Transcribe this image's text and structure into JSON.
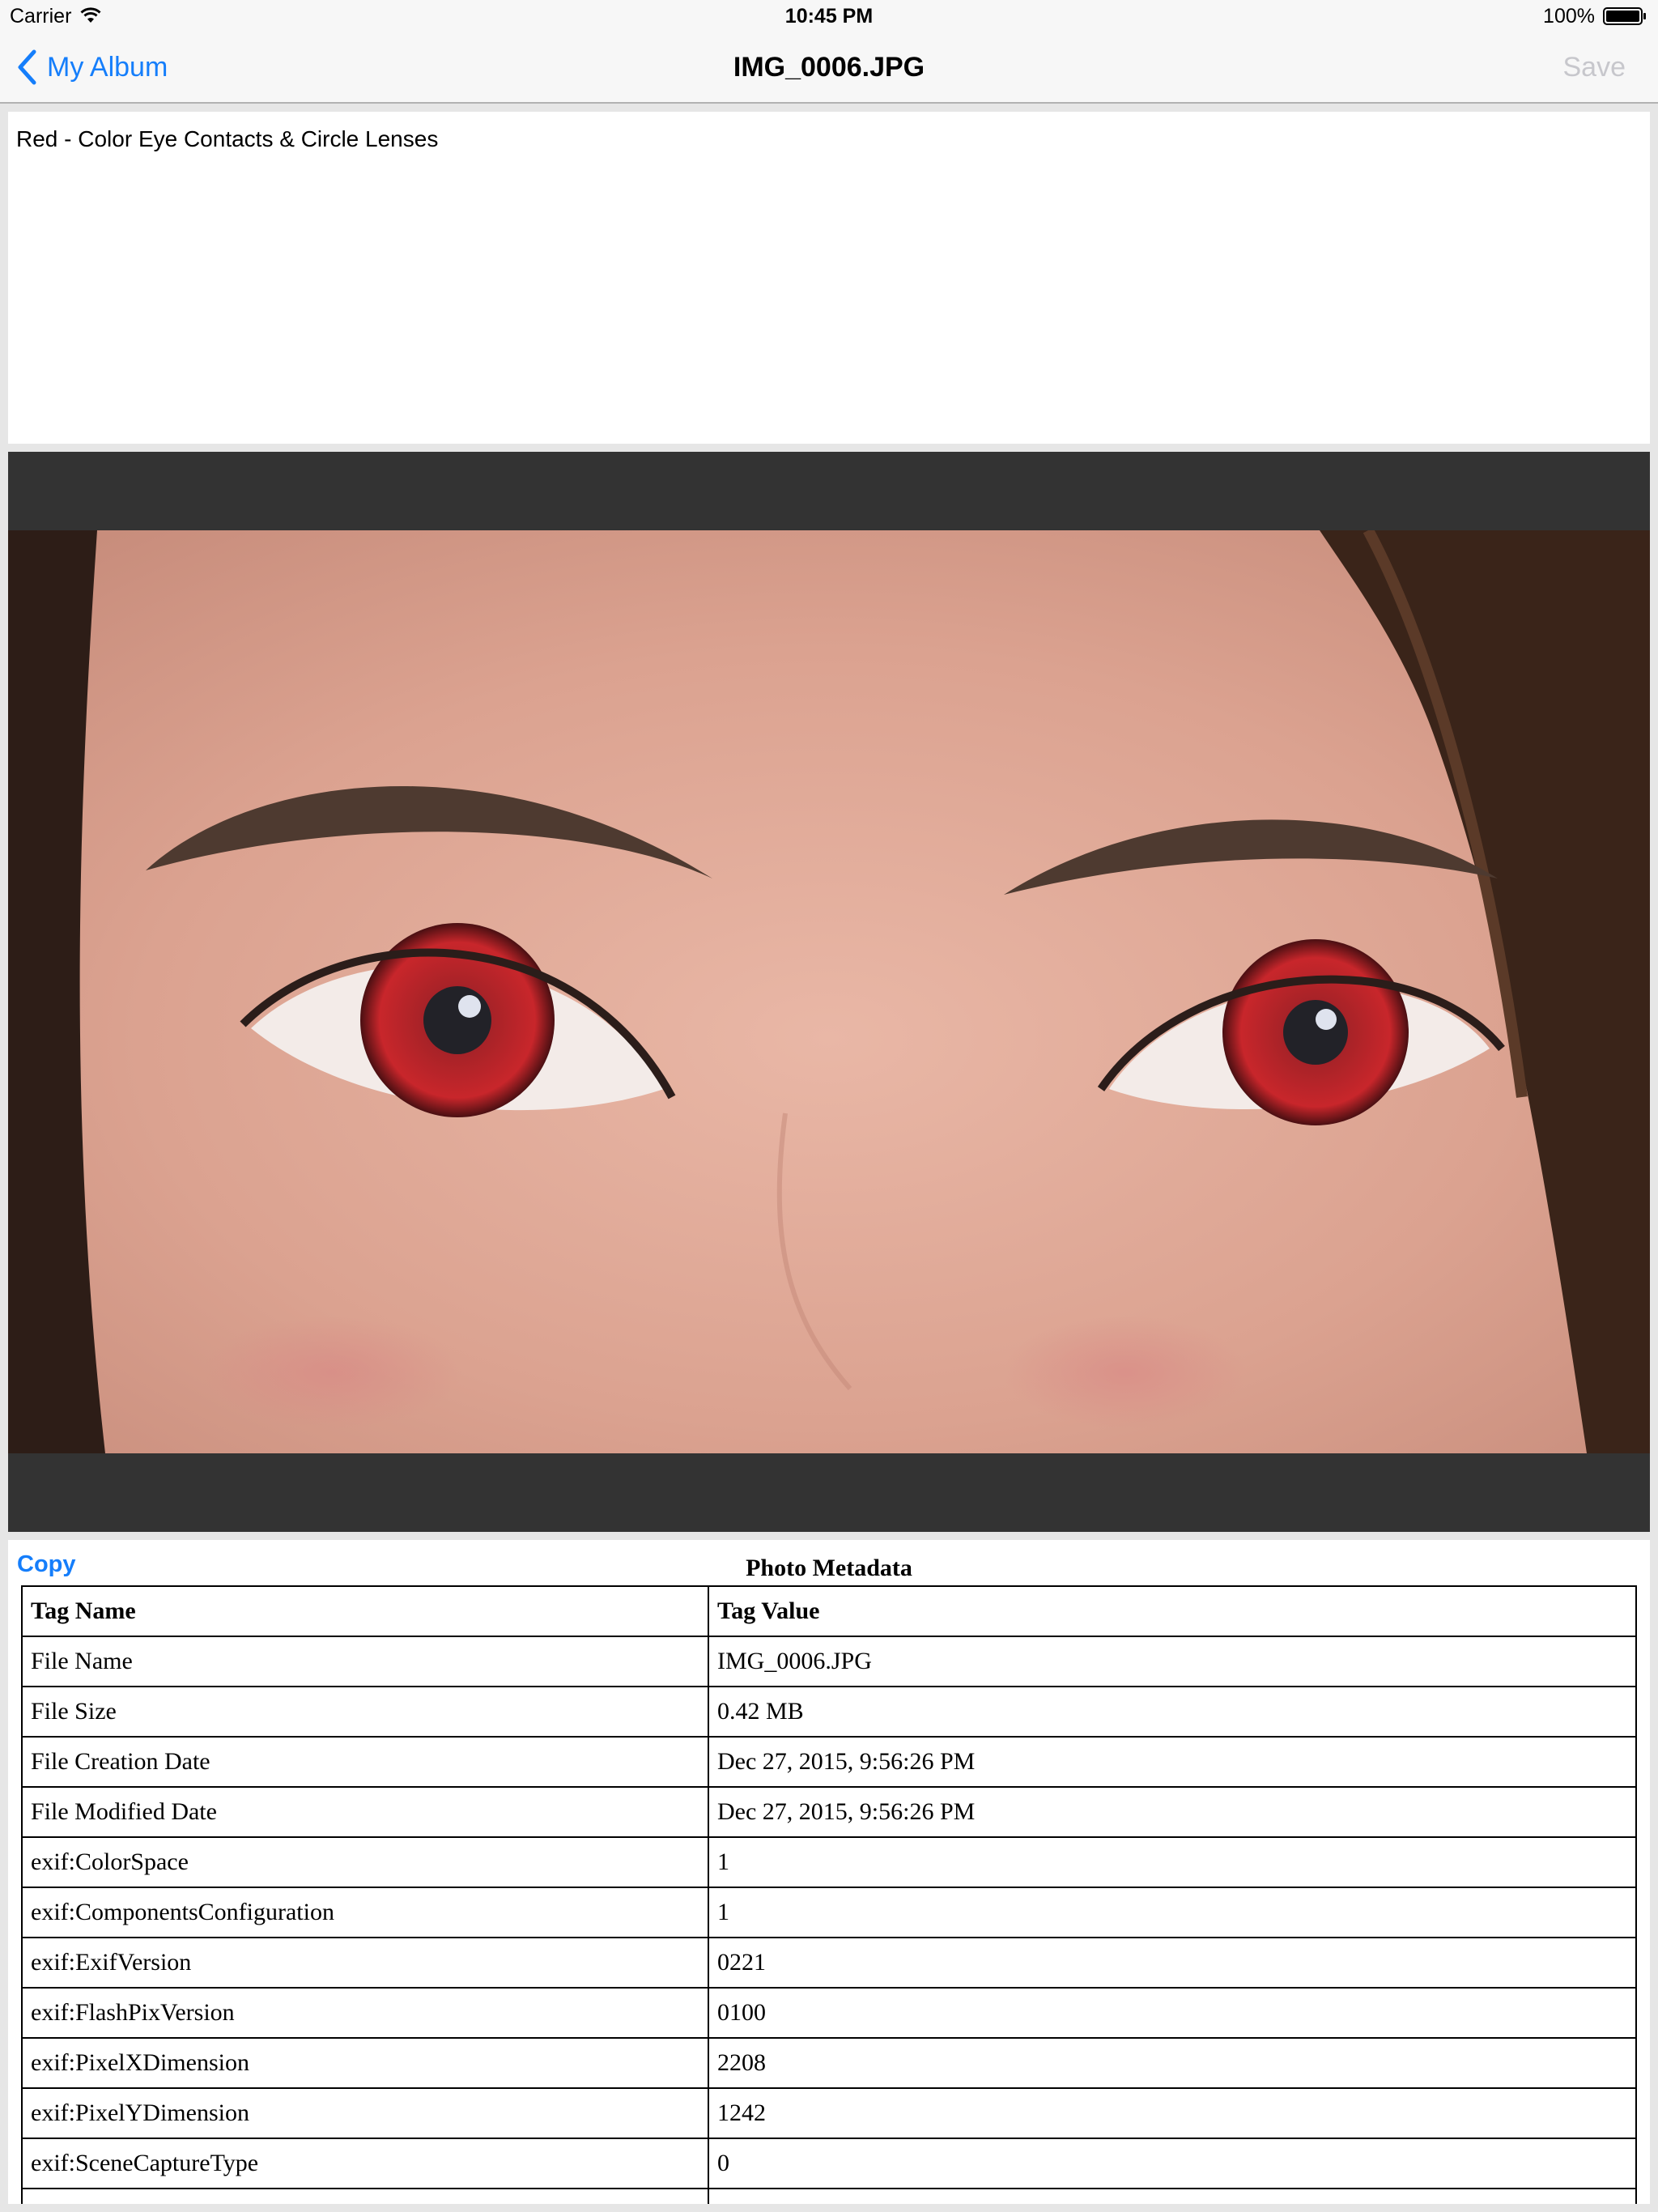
{
  "status_bar": {
    "carrier": "Carrier",
    "time": "10:45 PM",
    "battery_percent": "100%"
  },
  "nav": {
    "back_label": "My Album",
    "title": "IMG_0006.JPG",
    "save_label": "Save"
  },
  "description": {
    "text": "Red - Color Eye Contacts & Circle Lenses"
  },
  "metadata": {
    "copy_label": "Copy",
    "title": "Photo Metadata",
    "headers": [
      "Tag Name",
      "Tag Value"
    ],
    "rows": [
      {
        "name": "File Name",
        "value": "IMG_0006.JPG"
      },
      {
        "name": "File Size",
        "value": "0.42 MB"
      },
      {
        "name": "File Creation Date",
        "value": "Dec 27, 2015, 9:56:26 PM"
      },
      {
        "name": "File Modified Date",
        "value": "Dec 27, 2015, 9:56:26 PM"
      },
      {
        "name": "exif:ColorSpace",
        "value": "1"
      },
      {
        "name": "exif:ComponentsConfiguration",
        "value": "1"
      },
      {
        "name": "exif:ExifVersion",
        "value": "0221"
      },
      {
        "name": "exif:FlashPixVersion",
        "value": "0100"
      },
      {
        "name": "exif:PixelXDimension",
        "value": "2208"
      },
      {
        "name": "exif:PixelYDimension",
        "value": "1242"
      },
      {
        "name": "exif:SceneCaptureType",
        "value": "0"
      },
      {
        "name": "",
        "value": ""
      }
    ]
  },
  "colors": {
    "accent": "#157efb",
    "disabled": "#c7c7cc",
    "photo_frame": "#333333",
    "lens": "#c8262b"
  },
  "icons": {
    "back": "chevron-left-icon",
    "wifi": "wifi-icon",
    "battery": "battery-icon"
  }
}
